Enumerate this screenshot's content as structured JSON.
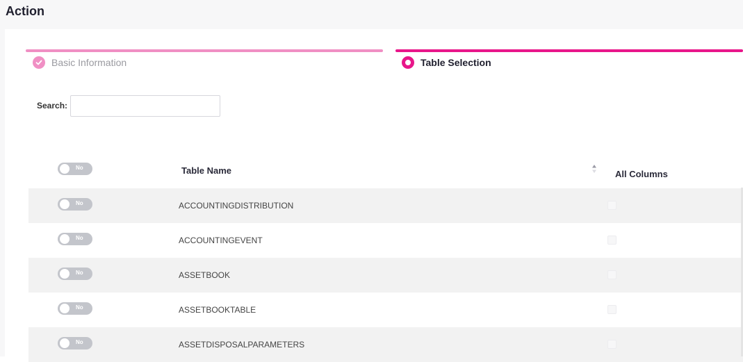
{
  "header": {
    "title": "Action"
  },
  "stepper": {
    "steps": [
      {
        "label": "Basic Information",
        "state": "completed",
        "icon": "check-circle-icon"
      },
      {
        "label": "Table Selection",
        "state": "active",
        "icon": "radio-ring-icon"
      }
    ],
    "completed_color": "#f08fc4",
    "active_color": "#e8168a"
  },
  "search": {
    "label": "Search:",
    "value": "",
    "placeholder": ""
  },
  "table": {
    "header": {
      "toggle_text": "No",
      "columns": [
        "Table Name",
        "All Columns"
      ],
      "sort_icon": "sort-arrows-icon"
    },
    "rows": [
      {
        "toggle_text": "No",
        "name": "ACCOUNTINGDISTRIBUTION",
        "all_columns": false
      },
      {
        "toggle_text": "No",
        "name": "ACCOUNTINGEVENT",
        "all_columns": false
      },
      {
        "toggle_text": "No",
        "name": "ASSETBOOK",
        "all_columns": false
      },
      {
        "toggle_text": "No",
        "name": "ASSETBOOKTABLE",
        "all_columns": false
      },
      {
        "toggle_text": "No",
        "name": "ASSETDISPOSALPARAMETERS",
        "all_columns": false
      }
    ]
  }
}
